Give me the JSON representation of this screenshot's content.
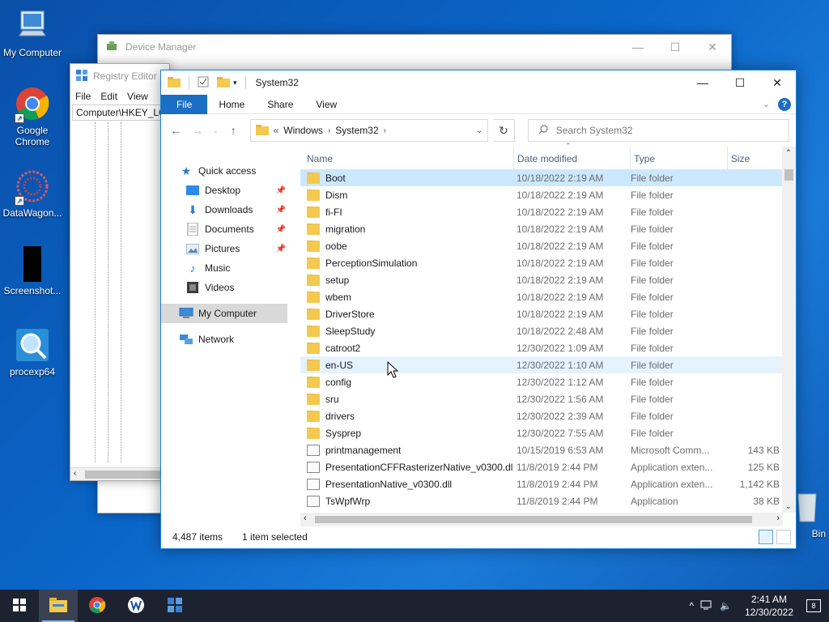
{
  "desktop": {
    "icons": [
      {
        "label": "My Computer",
        "icon": "computer-icon"
      },
      {
        "label": "Google Chrome",
        "icon": "chrome-icon"
      },
      {
        "label": "DataWagon...",
        "icon": "datawagon-icon"
      },
      {
        "label": "Screenshot...",
        "icon": "screenshot-icon"
      },
      {
        "label": "procexp64",
        "icon": "procexp-icon"
      },
      {
        "label": "Bin",
        "icon": "recycle-bin-icon"
      }
    ]
  },
  "device_manager": {
    "title": "Device Manager"
  },
  "registry_editor": {
    "title": "Registry Editor",
    "menu": [
      "File",
      "Edit",
      "View"
    ],
    "address": "Computer\\HKEY_LO"
  },
  "explorer": {
    "title": "System32",
    "ribbon": {
      "file": "File",
      "home": "Home",
      "share": "Share",
      "view": "View"
    },
    "address": {
      "prefix": "«",
      "crumbs": [
        "Windows",
        "System32"
      ]
    },
    "search_placeholder": "Search System32",
    "nav": {
      "quick_access": "Quick access",
      "desktop": "Desktop",
      "downloads": "Downloads",
      "documents": "Documents",
      "pictures": "Pictures",
      "music": "Music",
      "videos": "Videos",
      "my_computer": "My Computer",
      "network": "Network"
    },
    "columns": {
      "name": "Name",
      "date": "Date modified",
      "type": "Type",
      "size": "Size"
    },
    "files": [
      {
        "name": "Boot",
        "date": "10/18/2022 2:19 AM",
        "type": "File folder",
        "size": "",
        "kind": "folder"
      },
      {
        "name": "Dism",
        "date": "10/18/2022 2:19 AM",
        "type": "File folder",
        "size": "",
        "kind": "folder"
      },
      {
        "name": "fi-FI",
        "date": "10/18/2022 2:19 AM",
        "type": "File folder",
        "size": "",
        "kind": "folder"
      },
      {
        "name": "migration",
        "date": "10/18/2022 2:19 AM",
        "type": "File folder",
        "size": "",
        "kind": "folder"
      },
      {
        "name": "oobe",
        "date": "10/18/2022 2:19 AM",
        "type": "File folder",
        "size": "",
        "kind": "folder"
      },
      {
        "name": "PerceptionSimulation",
        "date": "10/18/2022 2:19 AM",
        "type": "File folder",
        "size": "",
        "kind": "folder"
      },
      {
        "name": "setup",
        "date": "10/18/2022 2:19 AM",
        "type": "File folder",
        "size": "",
        "kind": "folder"
      },
      {
        "name": "wbem",
        "date": "10/18/2022 2:19 AM",
        "type": "File folder",
        "size": "",
        "kind": "folder"
      },
      {
        "name": "DriverStore",
        "date": "10/18/2022 2:19 AM",
        "type": "File folder",
        "size": "",
        "kind": "folder"
      },
      {
        "name": "SleepStudy",
        "date": "10/18/2022 2:48 AM",
        "type": "File folder",
        "size": "",
        "kind": "folder"
      },
      {
        "name": "catroot2",
        "date": "12/30/2022 1:09 AM",
        "type": "File folder",
        "size": "",
        "kind": "folder"
      },
      {
        "name": "en-US",
        "date": "12/30/2022 1:10 AM",
        "type": "File folder",
        "size": "",
        "kind": "folder"
      },
      {
        "name": "config",
        "date": "12/30/2022 1:12 AM",
        "type": "File folder",
        "size": "",
        "kind": "folder"
      },
      {
        "name": "sru",
        "date": "12/30/2022 1:56 AM",
        "type": "File folder",
        "size": "",
        "kind": "folder"
      },
      {
        "name": "drivers",
        "date": "12/30/2022 2:39 AM",
        "type": "File folder",
        "size": "",
        "kind": "folder"
      },
      {
        "name": "Sysprep",
        "date": "12/30/2022 7:55 AM",
        "type": "File folder",
        "size": "",
        "kind": "folder"
      },
      {
        "name": "printmanagement",
        "date": "10/15/2019 6:53 AM",
        "type": "Microsoft Comm...",
        "size": "143 KB",
        "kind": "file"
      },
      {
        "name": "PresentationCFFRasterizerNative_v0300.dll",
        "date": "11/8/2019 2:44 PM",
        "type": "Application exten...",
        "size": "125 KB",
        "kind": "file"
      },
      {
        "name": "PresentationNative_v0300.dll",
        "date": "11/8/2019 2:44 PM",
        "type": "Application exten...",
        "size": "1,142 KB",
        "kind": "file"
      },
      {
        "name": "TsWpfWrp",
        "date": "11/8/2019 2:44 PM",
        "type": "Application",
        "size": "38 KB",
        "kind": "file"
      }
    ],
    "status": {
      "count": "4,487 items",
      "selected": "1 item selected"
    }
  },
  "taskbar": {
    "time": "2:41 AM",
    "date": "12/30/2022",
    "notifications": "8"
  }
}
